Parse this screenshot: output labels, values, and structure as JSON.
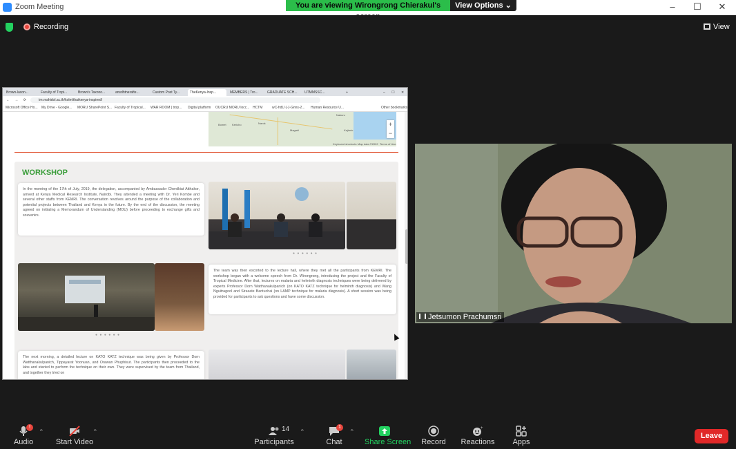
{
  "window": {
    "title": "Zoom Meeting"
  },
  "banner": {
    "viewing_text": "You are viewing Wirongrong Chierakul's screen",
    "view_options": "View Options"
  },
  "topbar": {
    "recording_label": "Recording",
    "view_label": "View"
  },
  "browser": {
    "tabs": [
      "Brown-laxon...",
      "Faculty of Tropi...",
      "Brown's Taxono...",
      "ansdhtnerafte...",
      "Custom Post Ty...",
      "TheKenya-Insp...",
      "MEMBERS | Tro...",
      "GRADUATE SCH...",
      "UTMMSSC..."
    ],
    "url": "tm.mahidol.ac.th/kolm/thaikenya-inspired/",
    "bookmarks": [
      "Microsoft Office Ho...",
      "My Drive - Google...",
      "MORU SharePoint S...",
      "Faculty of Tropical...",
      "WAR ROOM | trop...",
      "Digital platform",
      "OUCRU MORU locc...",
      "HCTM",
      "wC-hdU (-J-Gnns-2...",
      "Human Resource U...",
      "Other bookmarks"
    ]
  },
  "page": {
    "map_labels": [
      "Nakuru",
      "Narok",
      "Bomet",
      "Kericho",
      "Magadi",
      "Kajiado",
      "Keyboard shortcuts",
      "Map data ©2022",
      "Terms of Use"
    ],
    "section_title": "WORKSHOP",
    "para1": "In the morning of the 17th of July, 2019, the delegation, accompanied by Ambassador Cherdkiat Atthakor, arrived at Kenya Medical Research Institute, Nairobi. They attended a meeting with Dr. Yeri Kombe and several other staffs from KEMRI. The conversation revolves around the purpose of the collaboration and potential projects between Thailand and Kenya in the future. By the end of the discussion, the meeting agreed on initiating a Memorandum of Understanding (MOU) before proceeding to exchange gifts and souvenirs.",
    "para2": "The team was then escorted to the lecture hall, where they met all the participants from KEMRI. The workshop began with a welcome speech from Dr. Wirongrong, introducing the project and the Faculty of Tropical Medicine. After that, lectures on malaria and helminth diagnosis techniques were being delivered by experts Professor Dorn Watthanakulpanich (on KATO KATZ technique for helminth diagnosis) and Wang Nguitragool and Sirasate Bantuchai (on LAMP technique for malaria diagnosis). A short session was being provided for participants to ask questions and have some discussion.",
    "para3": "The next morning, a detailed lecture on KATO KATZ technique was being given by Professor Dorn Watthanakulpanich, Tippayarat Yoonuan, and Orawan Phuphisut. The participants then proceeded to the labs and started to perform the technique on their own. They were supervised by the team from Thailand, and together they tried on",
    "carousel_dots": "● ● ● ● ● ●"
  },
  "participant": {
    "name": "Jetsumon Prachumsri"
  },
  "toolbar": {
    "audio": "Audio",
    "audio_badge": "!",
    "start_video": "Start Video",
    "participants": "Participants",
    "participants_count": "14",
    "chat": "Chat",
    "chat_badge": "1",
    "share_screen": "Share Screen",
    "record": "Record",
    "reactions": "Reactions",
    "apps": "Apps",
    "leave": "Leave"
  },
  "colors": {
    "share_green": "#23d160",
    "leave_red": "#e02828",
    "banner_green": "#2bbd4a",
    "workshop_green": "#3a9d3a"
  }
}
